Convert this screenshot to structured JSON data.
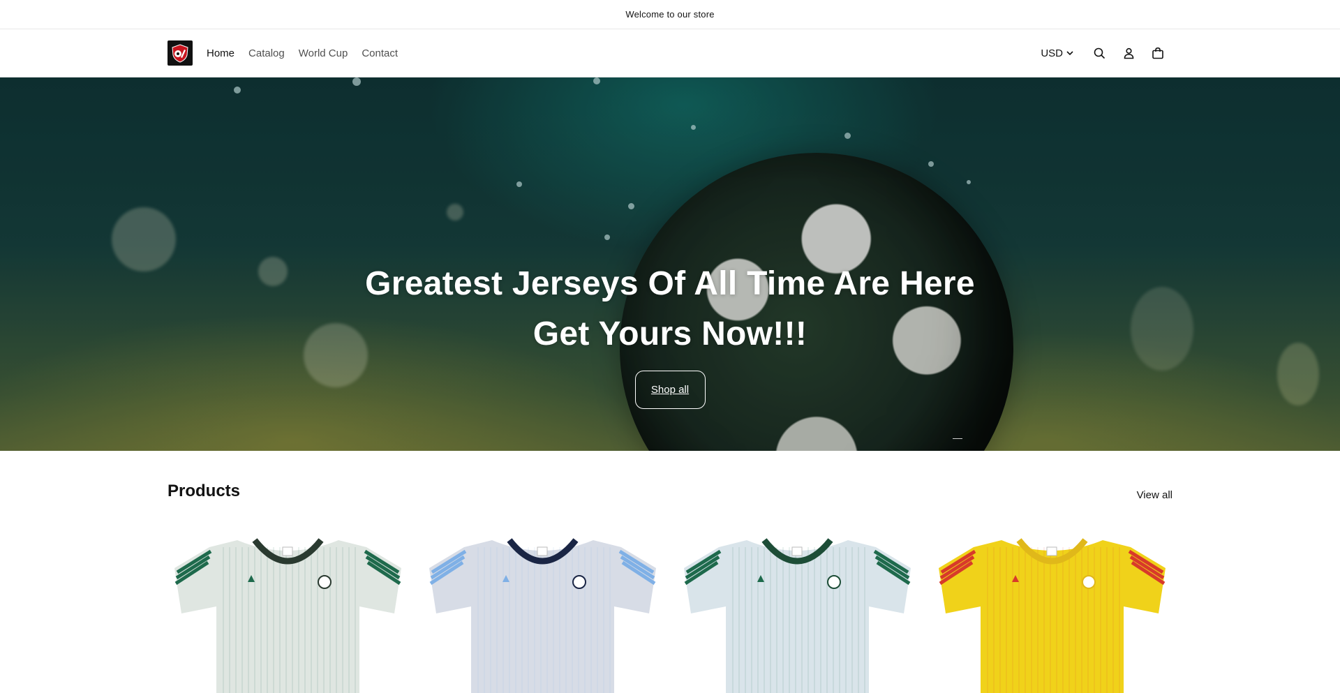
{
  "announcement": {
    "text": "Welcome to our store"
  },
  "header": {
    "nav": [
      {
        "label": "Home",
        "active": true
      },
      {
        "label": "Catalog",
        "active": false
      },
      {
        "label": "World Cup",
        "active": false
      },
      {
        "label": "Contact",
        "active": false
      }
    ],
    "currency": "USD",
    "icons": [
      "search-icon",
      "account-icon",
      "cart-icon"
    ]
  },
  "hero": {
    "title_line1": "Greatest Jerseys Of All Time Are Here",
    "title_line2": "Get Yours Now!!!",
    "button_label": "Shop all"
  },
  "products": {
    "title": "Products",
    "view_all": "View all",
    "items": [
      {
        "colors": {
          "body": "#dfe6e1",
          "stripe": "#1e6a4c",
          "collar": "#2a3a30"
        }
      },
      {
        "colors": {
          "body": "#d7dce6",
          "stripe": "#7fb0e6",
          "collar": "#1a2544"
        }
      },
      {
        "colors": {
          "body": "#d9e4ea",
          "stripe": "#1e6a4c",
          "collar": "#1d4d37"
        }
      },
      {
        "colors": {
          "body": "#f0d21a",
          "stripe": "#d83a2a",
          "collar": "#e0b81a"
        }
      }
    ]
  }
}
